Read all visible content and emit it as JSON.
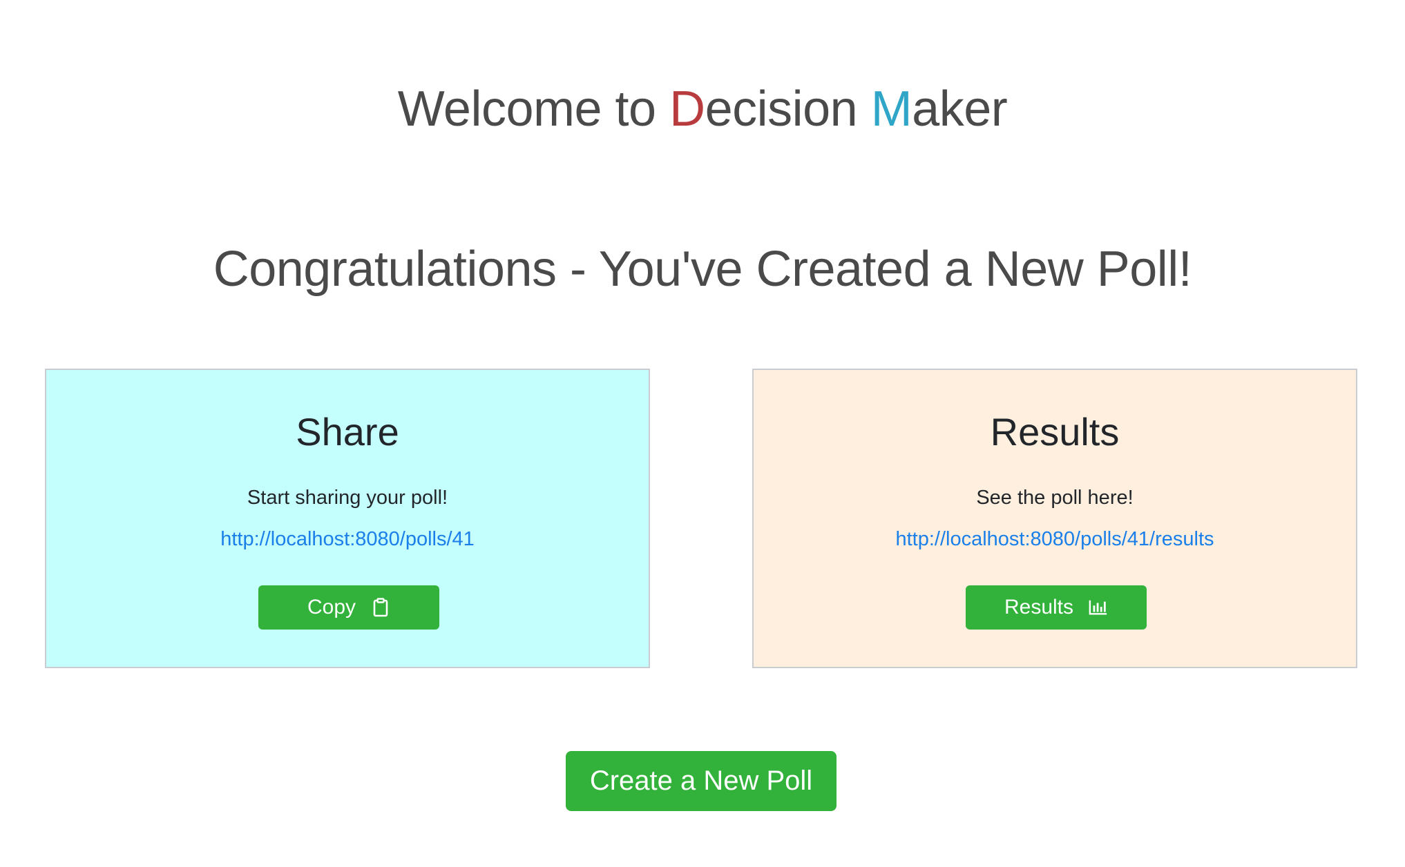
{
  "header": {
    "prefix": "Welcome to ",
    "word1_initial": "D",
    "word1_rest": "ecision ",
    "word2_initial": "M",
    "word2_rest": "aker",
    "colors": {
      "d_accent": "#b83b3e",
      "m_accent": "#2fa6c7"
    }
  },
  "main": {
    "heading": "Congratulations - You've Created a New Poll!",
    "share_card": {
      "title": "Share",
      "text": "Start sharing your poll!",
      "link": "http://localhost:8080/polls/41",
      "button_label": "Copy",
      "button_icon": "clipboard-icon",
      "background": "#c4fffd"
    },
    "results_card": {
      "title": "Results",
      "text": "See the poll here!",
      "link": "http://localhost:8080/polls/41/results",
      "button_label": "Results",
      "button_icon": "bar-chart-icon",
      "background": "#feefdf"
    },
    "create_button_label": "Create a New Poll",
    "button_color": "#32b23a",
    "link_color": "#1a7fe8"
  }
}
